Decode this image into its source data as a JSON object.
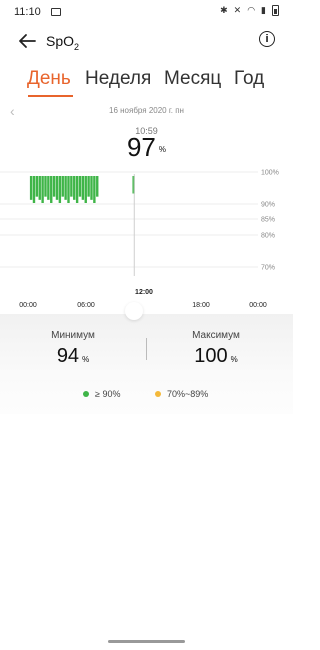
{
  "status": {
    "time": "11:10"
  },
  "header": {
    "title": "SpO",
    "title_sub": "2"
  },
  "tabs": [
    "День",
    "Неделя",
    "Месяц",
    "Год"
  ],
  "date_label": "16 ноября 2020 г. пн",
  "selected_time": "10:59",
  "selected_value": "97",
  "unit": "%",
  "chart_data": {
    "type": "bar",
    "y_ticks": [
      "100%",
      "90%",
      "85%",
      "80%",
      "70%"
    ],
    "x_ticks": [
      "00:00",
      "06:00",
      "12:00",
      "18:00",
      "00:00"
    ],
    "ylim": [
      70,
      100
    ],
    "series": [
      {
        "values": [
          {
            "t": 0.2,
            "y": 95
          },
          {
            "t": 0.5,
            "y": 94
          },
          {
            "t": 0.8,
            "y": 96
          },
          {
            "t": 1.1,
            "y": 95
          },
          {
            "t": 1.4,
            "y": 94
          },
          {
            "t": 1.7,
            "y": 96
          },
          {
            "t": 2.0,
            "y": 95
          },
          {
            "t": 2.3,
            "y": 94
          },
          {
            "t": 2.6,
            "y": 96
          },
          {
            "t": 2.9,
            "y": 95
          },
          {
            "t": 3.2,
            "y": 94
          },
          {
            "t": 3.5,
            "y": 96
          },
          {
            "t": 3.8,
            "y": 95
          },
          {
            "t": 4.1,
            "y": 94
          },
          {
            "t": 4.4,
            "y": 96
          },
          {
            "t": 4.7,
            "y": 95
          },
          {
            "t": 5.0,
            "y": 94
          },
          {
            "t": 5.3,
            "y": 96
          },
          {
            "t": 5.6,
            "y": 95
          },
          {
            "t": 5.9,
            "y": 94
          },
          {
            "t": 6.2,
            "y": 96
          },
          {
            "t": 6.5,
            "y": 95
          },
          {
            "t": 6.8,
            "y": 94
          },
          {
            "t": 7.1,
            "y": 96
          },
          {
            "t": 10.9,
            "y": 97
          }
        ]
      }
    ],
    "selected_time": "10:59"
  },
  "stats": {
    "min_label": "Минимум",
    "min_value": "94",
    "max_label": "Максимум",
    "max_value": "100"
  },
  "legend": {
    "high": "≥ 90%",
    "mid": "70%~89%",
    "high_color": "#3fb548",
    "mid_color": "#f4b93a"
  },
  "accent_color": "#e8642c"
}
